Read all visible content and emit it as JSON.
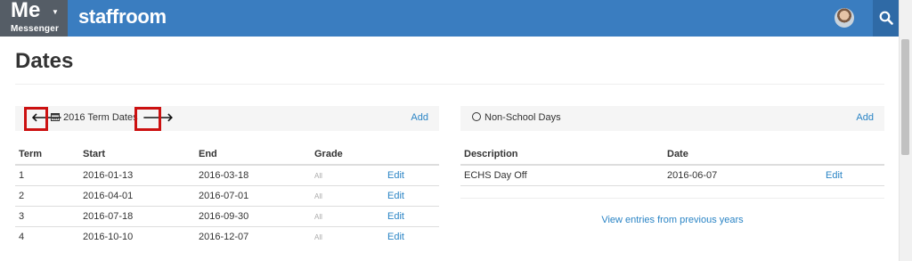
{
  "app": {
    "me_label": "Me",
    "me_sub": "Messenger",
    "brand": "staffroom"
  },
  "page": {
    "title": "Dates"
  },
  "term_panel": {
    "title": "2016 Term Dates",
    "add_label": "Add",
    "columns": [
      "Term",
      "Start",
      "End",
      "Grade",
      ""
    ],
    "rows": [
      {
        "term": "1",
        "start": "2016-01-13",
        "end": "2016-03-18",
        "grade": "All",
        "action": "Edit"
      },
      {
        "term": "2",
        "start": "2016-04-01",
        "end": "2016-07-01",
        "grade": "All",
        "action": "Edit"
      },
      {
        "term": "3",
        "start": "2016-07-18",
        "end": "2016-09-30",
        "grade": "All",
        "action": "Edit"
      },
      {
        "term": "4",
        "start": "2016-10-10",
        "end": "2016-12-07",
        "grade": "All",
        "action": "Edit"
      }
    ]
  },
  "nonschool_panel": {
    "title": "Non-School Days",
    "add_label": "Add",
    "columns": [
      "Description",
      "Date",
      ""
    ],
    "rows": [
      {
        "description": "ECHS Day Off",
        "date": "2016-06-07",
        "action": "Edit"
      }
    ],
    "previous_link": "View entries from previous years"
  },
  "colors": {
    "topbar": "#3a7dc0",
    "me_button": "#555d66",
    "link": "#2a84c5",
    "highlight": "#cc1111"
  }
}
